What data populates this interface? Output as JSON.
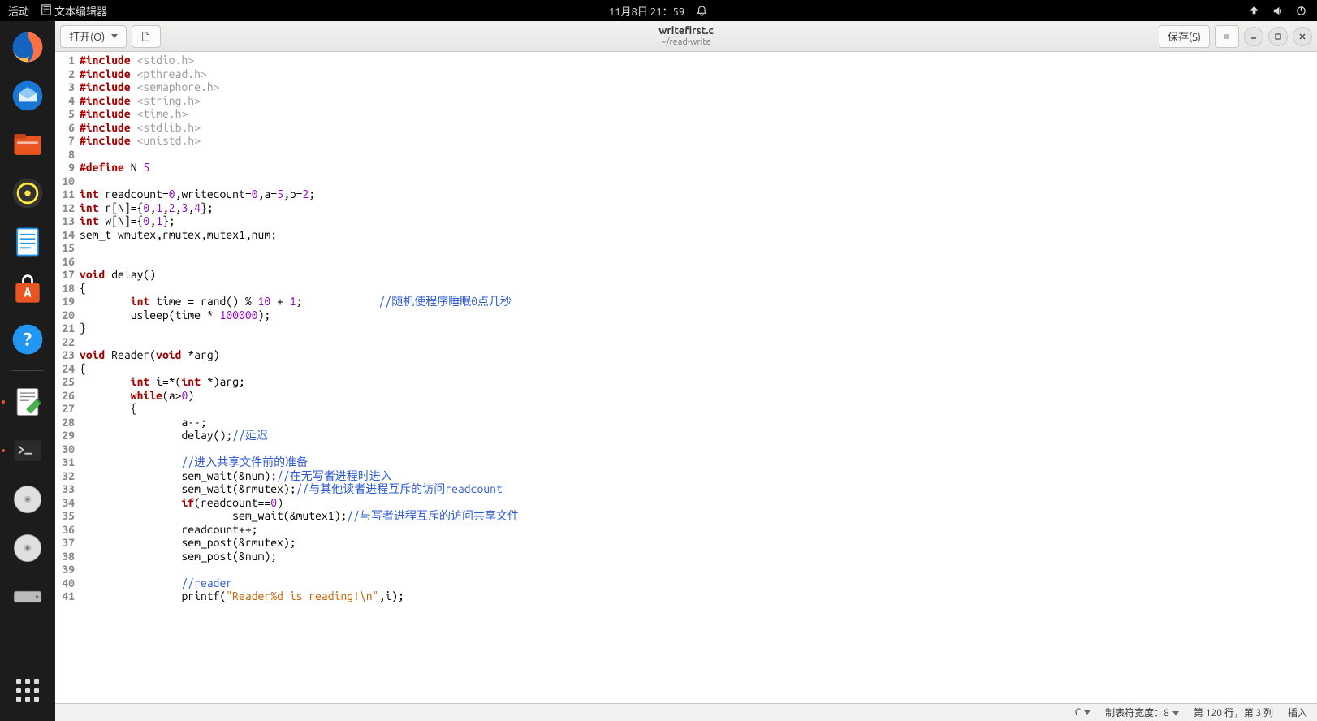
{
  "topbar": {
    "activities": "活动",
    "app": "文本编辑器",
    "datetime": "11月8日 21：59"
  },
  "headerbar": {
    "open": "打开(O)",
    "save": "保存(S)",
    "title": "writefirst.c",
    "subtitle": "~/read-write"
  },
  "statusbar": {
    "lang": "C",
    "tabwidth": "制表符宽度：8",
    "pos": "第 120 行，第 3 列",
    "mode": "插入"
  },
  "code": [
    {
      "n": 1,
      "segs": [
        [
          "kw",
          "#include"
        ],
        [
          " "
        ],
        [
          "hdr",
          "<stdio.h>"
        ]
      ]
    },
    {
      "n": 2,
      "segs": [
        [
          "kw",
          "#include"
        ],
        [
          " "
        ],
        [
          "hdr",
          "<pthread.h>"
        ]
      ]
    },
    {
      "n": 3,
      "segs": [
        [
          "kw",
          "#include"
        ],
        [
          " "
        ],
        [
          "hdr",
          "<semaphore.h>"
        ]
      ]
    },
    {
      "n": 4,
      "segs": [
        [
          "kw",
          "#include"
        ],
        [
          " "
        ],
        [
          "hdr",
          "<string.h>"
        ]
      ]
    },
    {
      "n": 5,
      "segs": [
        [
          "kw",
          "#include"
        ],
        [
          " "
        ],
        [
          "hdr",
          "<time.h>"
        ]
      ]
    },
    {
      "n": 6,
      "segs": [
        [
          "kw",
          "#include"
        ],
        [
          " "
        ],
        [
          "hdr",
          "<stdlib.h>"
        ]
      ]
    },
    {
      "n": 7,
      "segs": [
        [
          "kw",
          "#include"
        ],
        [
          " "
        ],
        [
          "hdr",
          "<unistd.h>"
        ]
      ]
    },
    {
      "n": 8,
      "segs": []
    },
    {
      "n": 9,
      "segs": [
        [
          "kw",
          "#define"
        ],
        [
          " N "
        ],
        [
          "num",
          "5"
        ]
      ]
    },
    {
      "n": 10,
      "segs": []
    },
    {
      "n": 11,
      "segs": [
        [
          "kw",
          "int"
        ],
        [
          " readcount="
        ],
        [
          "num",
          "0"
        ],
        [
          ",writecount="
        ],
        [
          "num",
          "0"
        ],
        [
          ",a="
        ],
        [
          "num",
          "5"
        ],
        [
          ",b="
        ],
        [
          "num",
          "2"
        ],
        [
          ";"
        ]
      ]
    },
    {
      "n": 12,
      "segs": [
        [
          "kw",
          "int"
        ],
        [
          " r[N]={"
        ],
        [
          "num",
          "0"
        ],
        [
          ","
        ],
        [
          "num",
          "1"
        ],
        [
          ","
        ],
        [
          "num",
          "2"
        ],
        [
          ","
        ],
        [
          "num",
          "3"
        ],
        [
          ","
        ],
        [
          "num",
          "4"
        ],
        [
          "};"
        ]
      ]
    },
    {
      "n": 13,
      "segs": [
        [
          "kw",
          "int"
        ],
        [
          " w[N]={"
        ],
        [
          "num",
          "0"
        ],
        [
          ","
        ],
        [
          "num",
          "1"
        ],
        [
          "};"
        ]
      ]
    },
    {
      "n": 14,
      "segs": [
        [
          "",
          "sem_t wmutex,rmutex,mutex1,num;"
        ]
      ]
    },
    {
      "n": 15,
      "segs": []
    },
    {
      "n": 16,
      "segs": []
    },
    {
      "n": 17,
      "segs": [
        [
          "kw",
          "void"
        ],
        [
          " delay()"
        ]
      ]
    },
    {
      "n": 18,
      "segs": [
        [
          "",
          "{"
        ]
      ]
    },
    {
      "n": 19,
      "segs": [
        [
          "",
          "        "
        ],
        [
          "kw",
          "int"
        ],
        [
          " time = rand() % "
        ],
        [
          "num",
          "10"
        ],
        [
          " + "
        ],
        [
          "num",
          "1"
        ],
        [
          ";            "
        ],
        [
          "cmt",
          "//随机使程序睡眠0点几秒"
        ]
      ]
    },
    {
      "n": 20,
      "segs": [
        [
          "",
          "        usleep(time * "
        ],
        [
          "num",
          "100000"
        ],
        [
          ");"
        ]
      ]
    },
    {
      "n": 21,
      "segs": [
        [
          "",
          "}"
        ]
      ]
    },
    {
      "n": 22,
      "segs": []
    },
    {
      "n": 23,
      "segs": [
        [
          "kw",
          "void"
        ],
        [
          " Reader("
        ],
        [
          "kw",
          "void"
        ],
        [
          " *arg)"
        ]
      ]
    },
    {
      "n": 24,
      "segs": [
        [
          "",
          "{"
        ]
      ]
    },
    {
      "n": 25,
      "segs": [
        [
          "",
          "        "
        ],
        [
          "kw",
          "int"
        ],
        [
          " i=*("
        ],
        [
          "kw",
          "int"
        ],
        [
          " *)arg;"
        ]
      ]
    },
    {
      "n": 26,
      "segs": [
        [
          "",
          "        "
        ],
        [
          "kw",
          "while"
        ],
        [
          "(a>"
        ],
        [
          "num",
          "0"
        ],
        [
          ")"
        ]
      ]
    },
    {
      "n": 27,
      "segs": [
        [
          "",
          "        {"
        ]
      ]
    },
    {
      "n": 28,
      "segs": [
        [
          "",
          "                a--;"
        ]
      ]
    },
    {
      "n": 29,
      "segs": [
        [
          "",
          "                delay();"
        ],
        [
          "cmt",
          "//延迟"
        ]
      ]
    },
    {
      "n": 30,
      "segs": []
    },
    {
      "n": 31,
      "segs": [
        [
          "",
          "                "
        ],
        [
          "cmt",
          "//进入共享文件前的准备"
        ]
      ]
    },
    {
      "n": 32,
      "segs": [
        [
          "",
          "                sem_wait(&num);"
        ],
        [
          "cmt",
          "//在无写者进程时进入"
        ]
      ]
    },
    {
      "n": 33,
      "segs": [
        [
          "",
          "                sem_wait(&rmutex);"
        ],
        [
          "cmt",
          "//与其他读者进程互斥的访问readcount"
        ]
      ]
    },
    {
      "n": 34,
      "segs": [
        [
          "",
          "                "
        ],
        [
          "kw",
          "if"
        ],
        [
          "(readcount=="
        ],
        [
          "num",
          "0"
        ],
        [
          ")"
        ]
      ]
    },
    {
      "n": 35,
      "segs": [
        [
          "",
          "                        sem_wait(&mutex1);"
        ],
        [
          "cmt",
          "//与写者进程互斥的访问共享文件"
        ]
      ]
    },
    {
      "n": 36,
      "segs": [
        [
          "",
          "                readcount++;"
        ]
      ]
    },
    {
      "n": 37,
      "segs": [
        [
          "",
          "                sem_post(&rmutex);"
        ]
      ]
    },
    {
      "n": 38,
      "segs": [
        [
          "",
          "                sem_post(&num);"
        ]
      ]
    },
    {
      "n": 39,
      "segs": []
    },
    {
      "n": 40,
      "segs": [
        [
          "",
          "                "
        ],
        [
          "cmt",
          "//reader"
        ]
      ]
    },
    {
      "n": 41,
      "segs": [
        [
          "",
          "                printf("
        ],
        [
          "str",
          "\"Reader%d is reading!\\n\""
        ],
        [
          ",i);"
        ]
      ]
    }
  ]
}
